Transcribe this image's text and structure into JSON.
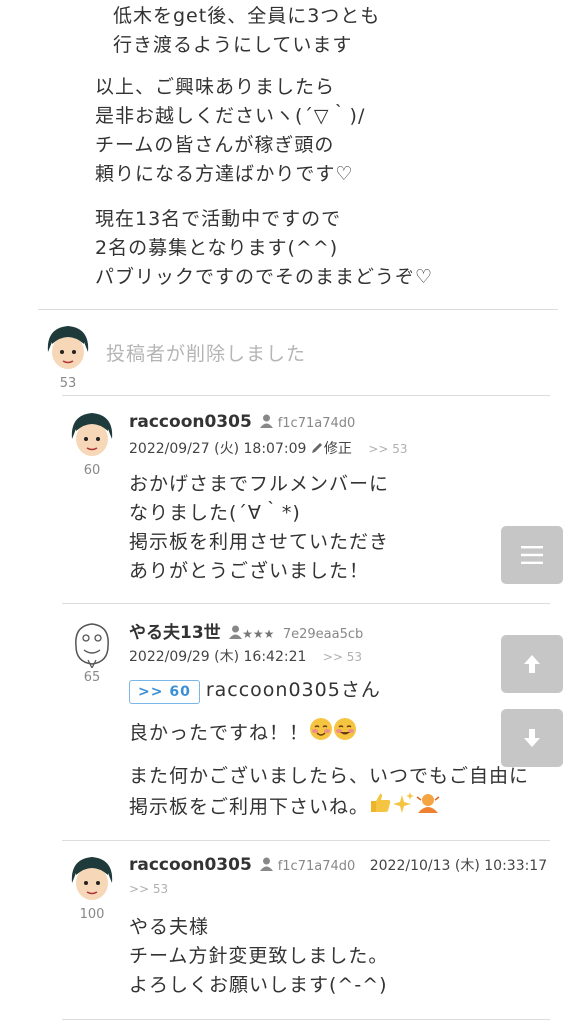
{
  "intro": {
    "indented_lines": [
      "低木をget後、全員に3つとも",
      "行き渡るようにしています"
    ],
    "para2": [
      "以上、ご興味ありましたら",
      "是非お越しくださいヽ(´▽｀)/",
      "チームの皆さんが稼ぎ頭の",
      "頼りになる方達ばかりです♡"
    ],
    "para3": [
      "現在13名で活動中ですので",
      "2名の募集となります(^^)",
      "パブリックですのでそのままどうぞ♡"
    ]
  },
  "deleted_post": {
    "text": "投稿者が削除しました",
    "number": "53"
  },
  "comments": [
    {
      "number": "60",
      "username": "raccoon0305",
      "user_id": "f1c71a74d0",
      "date": "2022/09/27 (火) 18:07:09",
      "edit_label": "修正",
      "reply_to": ">> 53",
      "lines": [
        "おかげさまでフルメンバーに",
        "なりました(´∀｀*)",
        "掲示板を利用させていただき",
        "ありがとうございました！"
      ]
    },
    {
      "number": "65",
      "username": "やる夫13世",
      "stars": "★★★",
      "user_id": "7e29eaa5cb",
      "date": "2022/09/29 (木) 16:42:21",
      "reply_to": ">> 53",
      "badge": ">> 60",
      "mention": "raccoon0305さん",
      "line1": "良かったですね！！",
      "lines": [
        "また何かございましたら、いつでもご自由に",
        "掲示板をご利用下さいね。"
      ]
    },
    {
      "number": "100",
      "username": "raccoon0305",
      "user_id": "f1c71a74d0",
      "date": "2022/10/13 (木) 10:33:17",
      "reply_to": ">> 53",
      "lines": [
        "やる夫様",
        "チーム方針変更致しました。",
        "よろしくお願いします(^-^)"
      ]
    }
  ],
  "controls": {
    "menu_icon": "menu-icon",
    "up_icon": "arrow-up-icon",
    "down_icon": "arrow-down-icon"
  },
  "colors": {
    "divider": "#dcdcdc",
    "badge_blue": "#3b8fd6",
    "float_btn": "#c6c6c6"
  }
}
